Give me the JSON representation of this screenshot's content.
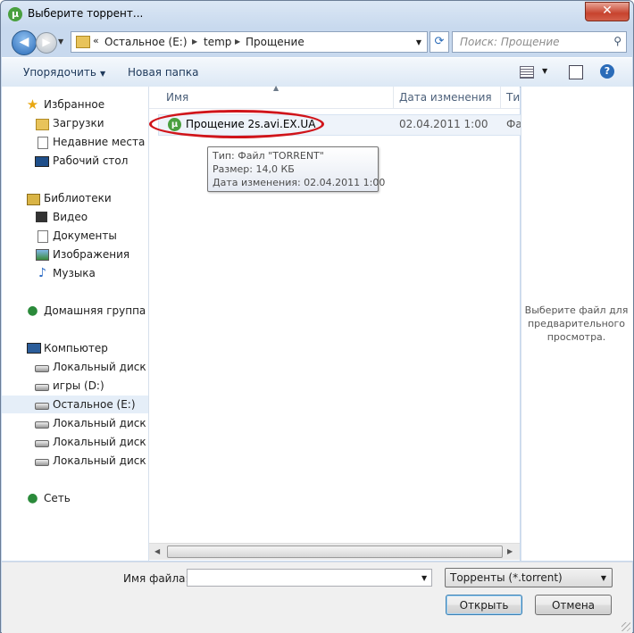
{
  "window": {
    "title": "Выберите торрент...",
    "close_label": "✕"
  },
  "navigation": {
    "address": {
      "prefix": "«",
      "crumbs": [
        "Остальное (E:)",
        "temp",
        "Прощение"
      ]
    },
    "search_placeholder": "Поиск: Прощение"
  },
  "toolbar": {
    "organize": "Упорядочить",
    "new_folder": "Новая папка"
  },
  "sidebar": {
    "favorites": "Избранное",
    "fav_items": [
      "Загрузки",
      "Недавние места",
      "Рабочий стол"
    ],
    "libraries": "Библиотеки",
    "lib_items": [
      "Видео",
      "Документы",
      "Изображения",
      "Музыка"
    ],
    "homegroup": "Домашняя группа",
    "computer": "Компьютер",
    "drives": [
      "Локальный диск (C",
      "игры (D:)",
      "Остальное (E:)",
      "Локальный диск (G",
      "Локальный диск (H",
      "Локальный диск (Z"
    ],
    "selected_drive": "Остальное (E:)",
    "network": "Сеть"
  },
  "file_list": {
    "columns": {
      "name": "Имя",
      "date": "Дата изменения",
      "type": "Ти"
    },
    "files": [
      {
        "name": "Прощение 2s.avi.EX.UA",
        "date": "02.04.2011 1:00",
        "type": "Фа"
      }
    ],
    "tooltip": {
      "type": "Тип: Файл \"TORRENT\"",
      "size": "Размер: 14,0 КБ",
      "modified": "Дата изменения: 02.04.2011 1:00"
    }
  },
  "preview": {
    "text": "Выберите файл для предварительного просмотра."
  },
  "footer": {
    "filename_label": "Имя файла:",
    "filename_value": "",
    "filetype": "Торренты (*.torrent)",
    "open_label": "Открыть",
    "cancel_label": "Отмена"
  },
  "colors": {
    "highlight_ring": "#d0141a",
    "utorrent_green": "#4aa03f"
  }
}
